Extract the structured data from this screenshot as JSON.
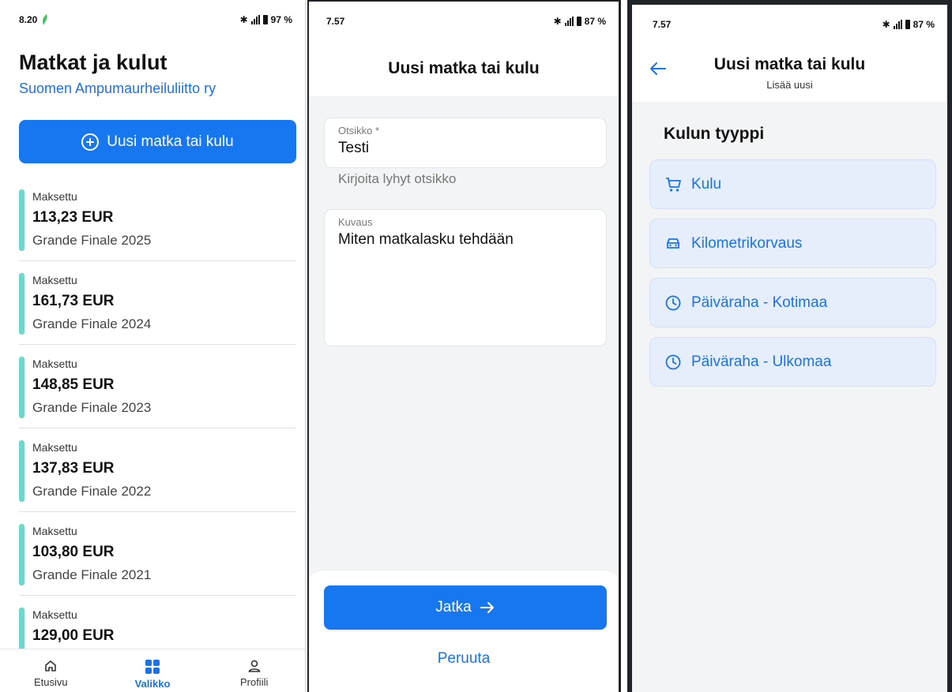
{
  "screen1": {
    "status": {
      "time": "8.20",
      "battery": "97 %"
    },
    "title": "Matkat ja kulut",
    "organization": "Suomen Ampumaurheiluliitto ry",
    "new_button": "Uusi matka tai kulu",
    "items": [
      {
        "status": "Maksettu",
        "amount": "113,23 EUR",
        "event": "Grande Finale 2025"
      },
      {
        "status": "Maksettu",
        "amount": "161,73 EUR",
        "event": "Grande Finale 2024"
      },
      {
        "status": "Maksettu",
        "amount": "148,85 EUR",
        "event": "Grande Finale 2023"
      },
      {
        "status": "Maksettu",
        "amount": "137,83 EUR",
        "event": "Grande Finale 2022"
      },
      {
        "status": "Maksettu",
        "amount": "103,80 EUR",
        "event": "Grande Finale 2021"
      },
      {
        "status": "Maksettu",
        "amount": "129,00 EUR",
        "event": ""
      }
    ],
    "nav": {
      "home": "Etusivu",
      "menu": "Valikko",
      "profile": "Profiili"
    },
    "accent": "#1677f0",
    "status_bar_color": "#6fd7cb"
  },
  "screen2": {
    "status": {
      "time": "7.57",
      "battery": "87 %"
    },
    "title": "Uusi matka tai kulu",
    "title_field": {
      "label": "Otsikko *",
      "value": "Testi",
      "helper": "Kirjoita lyhyt otsikko"
    },
    "description_field": {
      "label": "Kuvaus",
      "value": "Miten matkalasku tehdään"
    },
    "next_button": "Jatka",
    "cancel_link": "Peruuta"
  },
  "screen3": {
    "status": {
      "time": "7.57",
      "battery": "87 %"
    },
    "title": "Uusi matka tai kulu",
    "subtitle": "Lisää uusi",
    "section_title": "Kulun tyyppi",
    "options": [
      {
        "label": "Kulu",
        "icon": "cart-icon"
      },
      {
        "label": "Kilometrikorvaus",
        "icon": "car-icon"
      },
      {
        "label": "Päiväraha - Kotimaa",
        "icon": "clock-icon"
      },
      {
        "label": "Päiväraha - Ulkomaa",
        "icon": "clock-icon"
      }
    ]
  }
}
